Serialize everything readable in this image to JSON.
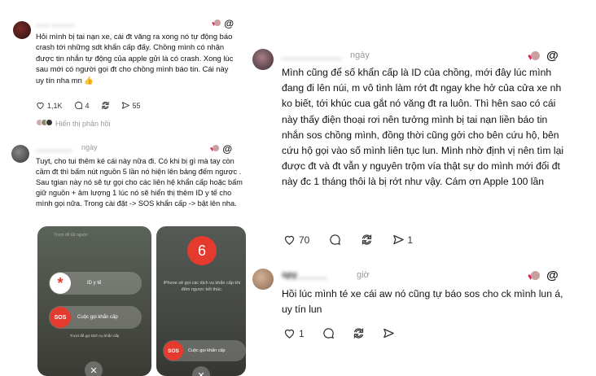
{
  "colors": {
    "heart": "#e0245e",
    "sos_red": "#e53b2f",
    "muted": "#999999"
  },
  "icons": [
    "heart-icon",
    "comment-icon",
    "repost-icon",
    "share-icon",
    "threads-logo-icon"
  ],
  "comment1": {
    "username": "___ _____",
    "body": "Hỏi mình bị tai nạn xe, cái đt văng ra xong nó tự động báo crash tới những sdt khẩn cấp đấy. Chồng mình có nhận được tin nhắn tự động của apple gửi là có crash. Xong lúc sau mới có người gọi đt cho chồng mình báo tin. Cái này uy tín nha mn 👍",
    "likes": "1,1K",
    "comments": "4",
    "shares": "55",
    "view_replies": "Hiển thị phản hồi"
  },
  "comment2": {
    "username": "________",
    "time": "ngày",
    "body": "Tuyt, cho tui thêm ké cái này nữa đi. Có khi bị gì mà tay còn cầm đt thì bấm nút nguồn 5 lần nó hiện lên bảng đếm ngược . Sau tgian này nó sẽ tự gọi cho các liên hệ khẩn cấp hoặc bấm giữ nguồn + âm lượng 1 lúc nó sẽ hiển thị thêm ID y tế cho mình gọi nữa. Trong cài đặt -> SOS khẩn cấp -> bật lên nha.",
    "phone1": {
      "top_caption": "Trượt để tắt nguồn",
      "medical_id": "ID y tế",
      "sos": "SOS",
      "emergency_call": "Cuộc gọi khẩn cấp",
      "bottom_caption": "Trượt để gọi Dịch vụ khẩn cấp"
    },
    "phone2": {
      "countdown": "6",
      "caption": "iPhone sẽ gọi các dịch vụ khẩn cấp khi đếm ngược kết thúc.",
      "sos": "SOS",
      "emergency_call": "Cuộc gọi khẩn cấp"
    }
  },
  "comment3": {
    "username": "____________",
    "time": "ngày",
    "body": "Mình cũng để số khẩn cấp là ID của chồng, mới đây lúc mình đang đi lên núi, m vô tình làm rớt đt ngay khe hở của cửa xe nh ko biết, tới khúc cua gắt nó văng đt ra luôn. Thì hên sao có cái này thấy điện thoại rơi nên tưởng mình bị tai nạn liền báo tin nhắn sos chồng mình, đồng thời cũng gởi cho bên cứu hộ, bên cứu hộ gọi vào số mình liên tục lun. Mình nhờ định vị nên tìm lại được đt và đt vẫn y nguyên trộm vía thật sự do mình mới đổi đt này đc 1 tháng thôi là bị rớt như vậy. Cám ơn Apple 100 lần",
    "likes": "70",
    "shares": "1"
  },
  "comment4": {
    "username": "spy______",
    "time": "giờ",
    "body": "Hồi lúc mình té xe cái aw nó cũng tự báo sos cho ck mình lun á, uy tín lun",
    "likes": "1"
  }
}
